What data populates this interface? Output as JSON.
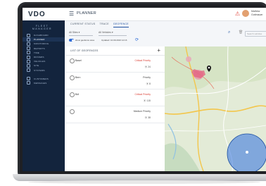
{
  "header": {
    "logo": "VDO",
    "app_title": "PLANNER",
    "user_name": "Mathew Gottmauer"
  },
  "sidebar": {
    "brand": "FLEET MANAGER",
    "items": [
      {
        "label": "DASHBOARD",
        "active": false
      },
      {
        "label": "PLANNER",
        "active": true
      },
      {
        "label": "MONITORING",
        "active": false
      },
      {
        "label": "REPORTS",
        "active": false
      },
      {
        "label": "TIME",
        "active": false
      },
      {
        "label": "DRIVERS",
        "active": false
      },
      {
        "label": "VEHICLES",
        "active": false
      },
      {
        "label": "SITE",
        "active": false
      },
      {
        "label": "SYSTEMS",
        "active": false
      },
      {
        "label": "CUSTOMERS",
        "active": false
      },
      {
        "label": "MESSAGES",
        "active": false
      }
    ]
  },
  "tabs": [
    {
      "label": "CURRENT STATUS",
      "active": false
    },
    {
      "label": "TRACE",
      "active": false
    },
    {
      "label": "GEOFENCE",
      "active": true
    }
  ],
  "filters": {
    "select_1": "All Sites",
    "select_2": "All Vehicles",
    "search_placeholder": "Search vehicles",
    "toggle_label": "show geofence area",
    "last_updated": "Updated: 10.09.2016 14:16"
  },
  "panel": {
    "title": "LIST OF GEOFENCES",
    "rows": [
      {
        "name": "Basel",
        "priority": "Critical Priority",
        "count": "24",
        "critical": true
      },
      {
        "name": "Bern",
        "priority": "Priority",
        "count": "8",
        "critical": false
      },
      {
        "name": "Bdl",
        "priority": "Critical Priority",
        "count": "115",
        "critical": true
      },
      {
        "name": "",
        "priority": "Medium Priority",
        "count": "38",
        "critical": false
      }
    ]
  },
  "colors": {
    "sidebar_bg": "#13243d",
    "accent": "#2e6bd6",
    "critical": "#d93a2f",
    "geofence_fill": "#2f6fe0"
  },
  "icons": [
    "menu-icon",
    "alert-icon",
    "search-icon",
    "trash-icon",
    "refresh-icon",
    "plus-icon",
    "location-pin-icon"
  ]
}
